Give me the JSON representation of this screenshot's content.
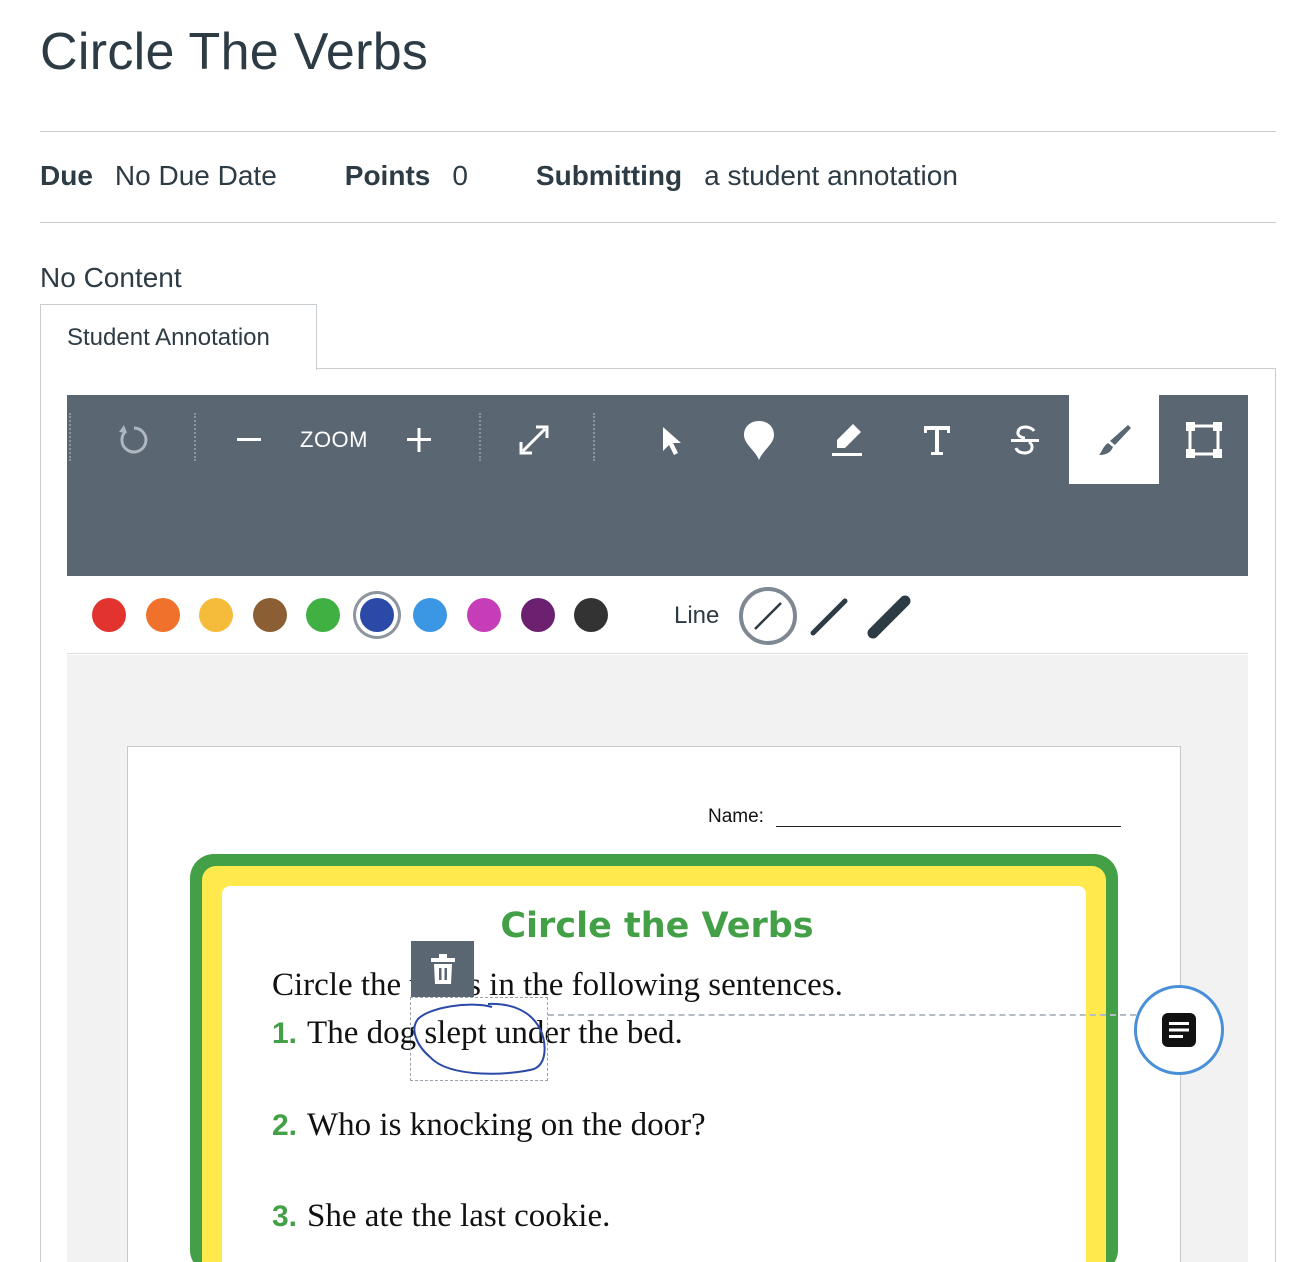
{
  "assignment": {
    "title": "Circle The Verbs",
    "due_label": "Due",
    "due_value": "No Due Date",
    "points_label": "Points",
    "points_value": "0",
    "submitting_label": "Submitting",
    "submitting_value": "a student annotation",
    "description": "No Content"
  },
  "tabs": [
    {
      "label": "Student Annotation",
      "active": true
    }
  ],
  "toolbar": {
    "zoom_label": "ZOOM",
    "tools": [
      {
        "name": "rotate",
        "icon": "rotate-icon"
      },
      {
        "name": "zoom-out",
        "icon": "minus-icon"
      },
      {
        "name": "zoom-in",
        "icon": "plus-icon"
      },
      {
        "name": "fit-page",
        "icon": "expand-icon"
      },
      {
        "name": "select",
        "icon": "pointer-icon"
      },
      {
        "name": "point",
        "icon": "pin-icon"
      },
      {
        "name": "highlight",
        "icon": "highlighter-icon"
      },
      {
        "name": "text",
        "icon": "text-icon"
      },
      {
        "name": "strikeout",
        "icon": "strikethrough-icon"
      },
      {
        "name": "draw",
        "icon": "brush-icon",
        "active": true
      },
      {
        "name": "area",
        "icon": "area-select-icon"
      }
    ]
  },
  "palette": {
    "colors": [
      "#e2332e",
      "#f0712b",
      "#f5bb3a",
      "#8b5e34",
      "#3fb041",
      "#2b4aa8",
      "#3b97e3",
      "#c53eb8",
      "#6b2170",
      "#333333"
    ],
    "selected_color": "#2b4aa8",
    "line_label": "Line",
    "line_widths": [
      "none",
      "thin",
      "thick"
    ]
  },
  "document": {
    "name_label": "Name:",
    "title": "Circle the Verbs",
    "instruction": "Circle the verbs in the following sentences.",
    "items": [
      {
        "number": "1.",
        "text": "The dog slept under the bed."
      },
      {
        "number": "2.",
        "text": "Who is knocking on the door?"
      },
      {
        "number": "3.",
        "text": "She ate the last cookie."
      }
    ],
    "title_color": "#43a047"
  },
  "colors": {
    "toolbar_bg": "#5b6673",
    "border": "#c7cdd1",
    "comment_ring": "#4a90d9",
    "frame_green": "#43a047",
    "frame_yellow": "#ffe94d"
  }
}
